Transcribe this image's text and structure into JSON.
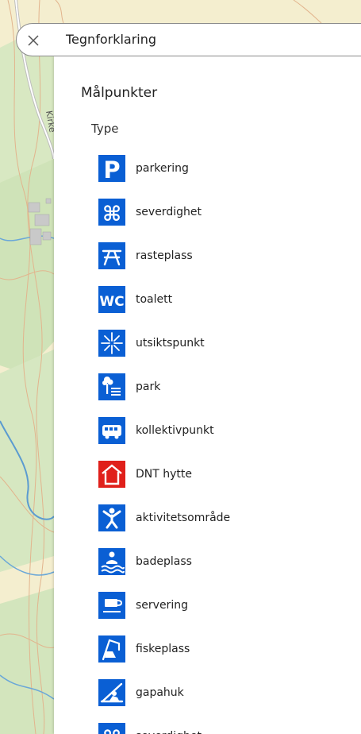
{
  "header": {
    "title": "Tegnforklaring",
    "close_icon": "close-icon"
  },
  "legend": {
    "section_title": "Målpunkter",
    "type_label": "Type",
    "items": [
      {
        "label": "parkering",
        "icon": "parking-icon",
        "color": "#0a5fd4"
      },
      {
        "label": "severdighet",
        "icon": "sight-icon",
        "color": "#0a5fd4"
      },
      {
        "label": "rasteplass",
        "icon": "picnic-table-icon",
        "color": "#0a5fd4"
      },
      {
        "label": "toalett",
        "icon": "wc-icon",
        "color": "#0a5fd4"
      },
      {
        "label": "utsiktspunkt",
        "icon": "viewpoint-icon",
        "color": "#0a5fd4"
      },
      {
        "label": "park",
        "icon": "park-icon",
        "color": "#0a5fd4"
      },
      {
        "label": "kollektivpunkt",
        "icon": "bus-icon",
        "color": "#0a5fd4"
      },
      {
        "label": "DNT hytte",
        "icon": "cabin-icon",
        "color": "#e0201b"
      },
      {
        "label": "aktivitetsområde",
        "icon": "activity-icon",
        "color": "#0a5fd4"
      },
      {
        "label": "badeplass",
        "icon": "swimming-icon",
        "color": "#0a5fd4"
      },
      {
        "label": "servering",
        "icon": "cafe-icon",
        "color": "#0a5fd4"
      },
      {
        "label": "fiskeplass",
        "icon": "fishing-icon",
        "color": "#0a5fd4"
      },
      {
        "label": "gapahuk",
        "icon": "shelter-icon",
        "color": "#0a5fd4"
      },
      {
        "label": "severdighet",
        "icon": "sight-icon",
        "color": "#0a5fd4"
      }
    ]
  },
  "map": {
    "road_label": "Kirke"
  }
}
